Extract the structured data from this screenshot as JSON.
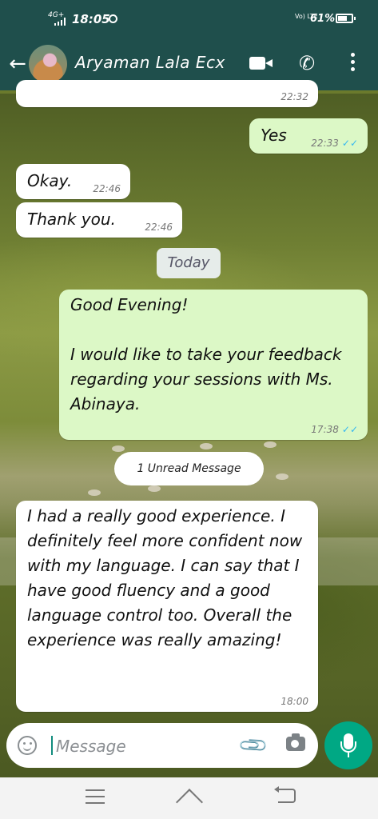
{
  "status_bar": {
    "network": "4G+",
    "time": "18:05",
    "volte": "Vo) LTE",
    "battery": "61%"
  },
  "header": {
    "contact_name": "Aryaman Lala Ecx",
    "icons": [
      "back-arrow-icon",
      "video-call-icon",
      "phone-call-icon",
      "more-options-icon"
    ]
  },
  "messages": [
    {
      "direction": "incoming",
      "text": "",
      "time": "22:32",
      "partial": true
    },
    {
      "direction": "outgoing",
      "text": "Yes",
      "time": "22:33",
      "ticks": "✓✓"
    },
    {
      "direction": "incoming",
      "text": "Okay.",
      "time": "22:46"
    },
    {
      "direction": "incoming",
      "text": "Thank you.",
      "time": "22:46"
    },
    {
      "direction": "outgoing",
      "text": "Good Evening!\n\nI would like to take your feedback regarding your sessions with Ms. Abinaya.",
      "time": "17:38",
      "ticks": "✓✓"
    },
    {
      "direction": "incoming",
      "text": "I had a really good experience. I definitely feel more confident now with my language. I can say that I have good fluency and a good language control too. Overall the experience was really amazing!",
      "time": "18:00"
    }
  ],
  "date_chip": "Today",
  "unread_banner": "1 Unread Message",
  "input": {
    "placeholder": "Message"
  },
  "accent_colors": {
    "header": "#1f4f4c",
    "outgoing_bubble": "#dcf8c6",
    "mic_button": "#00a884",
    "read_ticks": "#34b7f1"
  }
}
